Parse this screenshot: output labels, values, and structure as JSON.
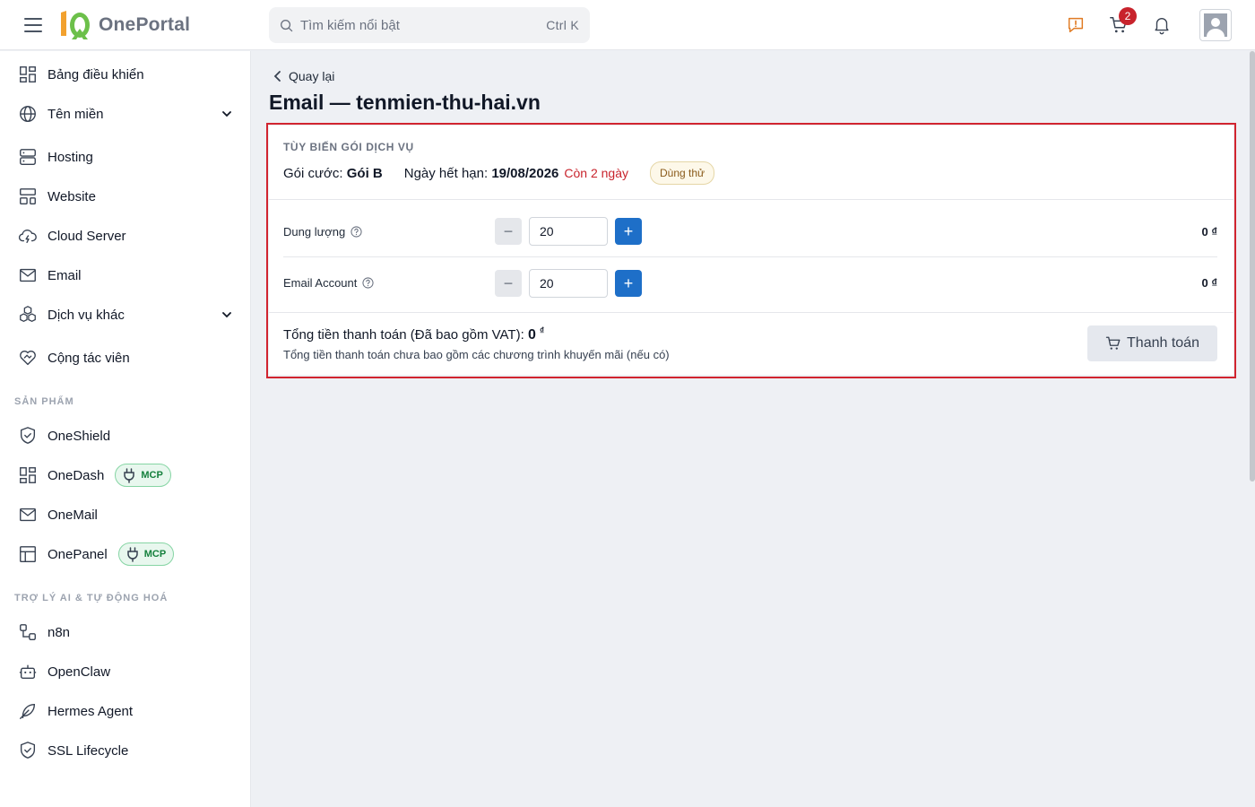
{
  "header": {
    "logo_text": "OnePortal",
    "search_placeholder": "Tìm kiếm nổi bật",
    "search_shortcut": "Ctrl K",
    "cart_count": "2",
    "colors": {
      "accent": "#1e6fc8",
      "alert": "#c8232c",
      "logo_green": "#6cc04a",
      "logo_orange": "#f2a12e"
    }
  },
  "sidebar": {
    "items": [
      {
        "label": "Bảng điều khiển",
        "icon": "dashboard-icon"
      },
      {
        "label": "Tên miền",
        "icon": "globe-icon",
        "expandable": true
      },
      {
        "label": "Hosting",
        "icon": "server-icon"
      },
      {
        "label": "Website",
        "icon": "layout-icon"
      },
      {
        "label": "Cloud Server",
        "icon": "cloud-icon"
      },
      {
        "label": "Email",
        "icon": "mail-icon"
      },
      {
        "label": "Dịch vụ khác",
        "icon": "boxes-icon",
        "expandable": true
      },
      {
        "label": "Cộng tác viên",
        "icon": "handshake-heart-icon"
      }
    ],
    "products_title": "SẢN PHẨM",
    "products": [
      {
        "label": "OneShield",
        "icon": "shield-check-icon"
      },
      {
        "label": "OneDash",
        "icon": "dashboard-icon",
        "badge": "MCP"
      },
      {
        "label": "OneMail",
        "icon": "mail-icon"
      },
      {
        "label": "OnePanel",
        "icon": "panel-icon",
        "badge": "MCP"
      }
    ],
    "ai_title": "TRỢ LÝ AI & TỰ ĐỘNG HOÁ",
    "ai_items": [
      {
        "label": "n8n",
        "icon": "workflow-icon"
      },
      {
        "label": "OpenClaw",
        "icon": "bot-icon"
      },
      {
        "label": "Hermes Agent",
        "icon": "feather-icon"
      },
      {
        "label": "SSL Lifecycle",
        "icon": "shield-check-icon"
      }
    ]
  },
  "main": {
    "back_label": "Quay lại",
    "title": "Email — tenmien-thu-hai.vn",
    "card": {
      "subtitle": "TÙY BIẾN GÓI DỊCH VỤ",
      "plan_label": "Gói cước:",
      "plan_value": "Gói B",
      "expiry_label": "Ngày hết hạn:",
      "expiry_value": "19/08/2026",
      "remaining": "Còn 2 ngày",
      "status_badge": "Dùng thử",
      "rows": [
        {
          "label": "Dung lượng",
          "value": "20",
          "price": "0 ₫"
        },
        {
          "label": "Email Account",
          "value": "20",
          "price": "0 ₫"
        }
      ],
      "total_label": "Tổng tiền thanh toán (Đã bao gồm VAT):",
      "total_value": "0",
      "total_currency": "₫",
      "note": "Tổng tiền thanh toán chưa bao gồm các chương trình khuyến mãi (nếu có)",
      "pay_label": "Thanh toán"
    }
  }
}
